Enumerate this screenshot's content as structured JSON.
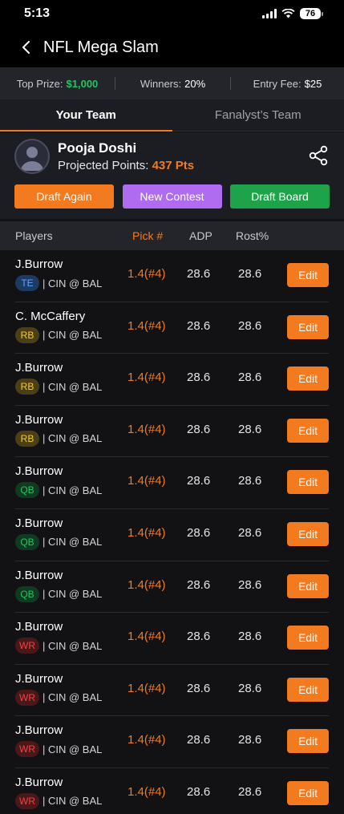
{
  "status": {
    "time": "5:13",
    "battery": "76"
  },
  "header": {
    "title": "NFL Mega Slam"
  },
  "info": {
    "top_prize_label": "Top Prize:",
    "top_prize_value": "$1,000",
    "winners_label": "Winners:",
    "winners_value": "20%",
    "entry_fee_label": "Entry Fee:",
    "entry_fee_value": "$25"
  },
  "tabs": [
    {
      "label": "Your Team",
      "active": true
    },
    {
      "label": "Fanalyst’s Team",
      "active": false
    }
  ],
  "profile": {
    "name": "Pooja Doshi",
    "points_label": "Projected Points:",
    "points_value": "437 Pts"
  },
  "buttons": {
    "draft_again": "Draft Again",
    "new_contest": "New Contest",
    "draft_board": "Draft Board"
  },
  "table": {
    "columns": {
      "players": "Players",
      "pick": "Pick #",
      "adp": "ADP",
      "rost": "Rost%"
    },
    "edit_label": "Edit",
    "rows": [
      {
        "name": "J.Burrow",
        "pos": "TE",
        "matchup": "| CIN @ BAL",
        "pick": "1.4(#4)",
        "adp": "28.6",
        "rost": "28.6"
      },
      {
        "name": "C. McCaffery",
        "pos": "RB",
        "matchup": "| CIN @ BAL",
        "pick": "1.4(#4)",
        "adp": "28.6",
        "rost": "28.6"
      },
      {
        "name": "J.Burrow",
        "pos": "RB",
        "matchup": "| CIN @ BAL",
        "pick": "1.4(#4)",
        "adp": "28.6",
        "rost": "28.6"
      },
      {
        "name": "J.Burrow",
        "pos": "RB",
        "matchup": "| CIN @ BAL",
        "pick": "1.4(#4)",
        "adp": "28.6",
        "rost": "28.6"
      },
      {
        "name": "J.Burrow",
        "pos": "QB",
        "matchup": "| CIN @ BAL",
        "pick": "1.4(#4)",
        "adp": "28.6",
        "rost": "28.6"
      },
      {
        "name": "J.Burrow",
        "pos": "QB",
        "matchup": "| CIN @ BAL",
        "pick": "1.4(#4)",
        "adp": "28.6",
        "rost": "28.6"
      },
      {
        "name": "J.Burrow",
        "pos": "QB",
        "matchup": "| CIN @ BAL",
        "pick": "1.4(#4)",
        "adp": "28.6",
        "rost": "28.6"
      },
      {
        "name": "J.Burrow",
        "pos": "WR",
        "matchup": "| CIN @ BAL",
        "pick": "1.4(#4)",
        "adp": "28.6",
        "rost": "28.6"
      },
      {
        "name": "J.Burrow",
        "pos": "WR",
        "matchup": "| CIN @ BAL",
        "pick": "1.4(#4)",
        "adp": "28.6",
        "rost": "28.6"
      },
      {
        "name": "J.Burrow",
        "pos": "WR",
        "matchup": "| CIN @ BAL",
        "pick": "1.4(#4)",
        "adp": "28.6",
        "rost": "28.6"
      },
      {
        "name": "J.Burrow",
        "pos": "WR",
        "matchup": "| CIN @ BAL",
        "pick": "1.4(#4)",
        "adp": "28.6",
        "rost": "28.6"
      }
    ]
  },
  "colors": {
    "accent": "#f47a20",
    "green": "#22c55e",
    "purple": "#b06cf0",
    "background": "#121214"
  }
}
